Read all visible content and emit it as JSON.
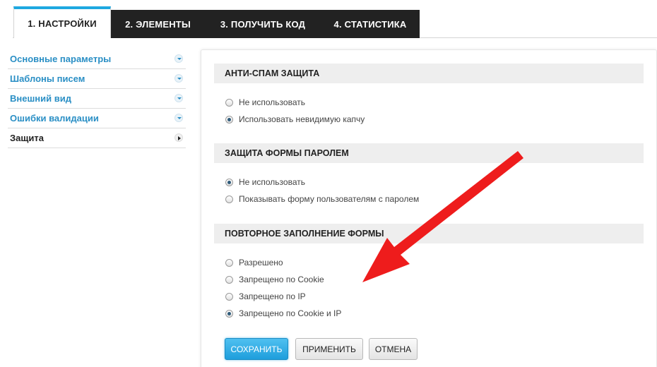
{
  "tabs": [
    {
      "label": "1. НАСТРОЙКИ",
      "active": true
    },
    {
      "label": "2. ЭЛЕМЕНТЫ",
      "active": false
    },
    {
      "label": "3. ПОЛУЧИТЬ КОД",
      "active": false
    },
    {
      "label": "4. СТАТИСТИКА",
      "active": false
    }
  ],
  "sidebar": {
    "items": [
      {
        "label": "Основные параметры",
        "icon": "chevron-down-icon"
      },
      {
        "label": "Шаблоны писем",
        "icon": "chevron-down-icon"
      },
      {
        "label": "Внешний вид",
        "icon": "chevron-down-icon"
      },
      {
        "label": "Ошибки валидации",
        "icon": "chevron-down-icon"
      },
      {
        "label": "Защита",
        "icon": "chevron-right-icon",
        "active": true
      }
    ]
  },
  "sections": {
    "antispam": {
      "title": "АНТИ-СПАМ ЗАЩИТА",
      "options": [
        {
          "label": "Не использовать",
          "checked": false
        },
        {
          "label": "Использовать невидимую капчу",
          "checked": true
        }
      ]
    },
    "password": {
      "title": "ЗАЩИТА ФОРМЫ ПАРОЛЕМ",
      "options": [
        {
          "label": "Не использовать",
          "checked": true
        },
        {
          "label": "Показывать форму пользователям с паролем",
          "checked": false
        }
      ]
    },
    "refill": {
      "title": "ПОВТОРНОЕ ЗАПОЛНЕНИЕ ФОРМЫ",
      "options": [
        {
          "label": "Разрешено",
          "checked": false
        },
        {
          "label": "Запрещено по Cookie",
          "checked": false
        },
        {
          "label": "Запрещено по IP",
          "checked": false
        },
        {
          "label": "Запрещено по Cookie и IP",
          "checked": true
        }
      ]
    }
  },
  "buttons": {
    "save": "СОХРАНИТЬ",
    "apply": "ПРИМЕНИТЬ",
    "cancel": "ОТМЕНА"
  },
  "colors": {
    "accent": "#1ea8e0",
    "link": "#2a8fc5",
    "tab_dark": "#222222",
    "arrow": "#ee1c1c"
  }
}
